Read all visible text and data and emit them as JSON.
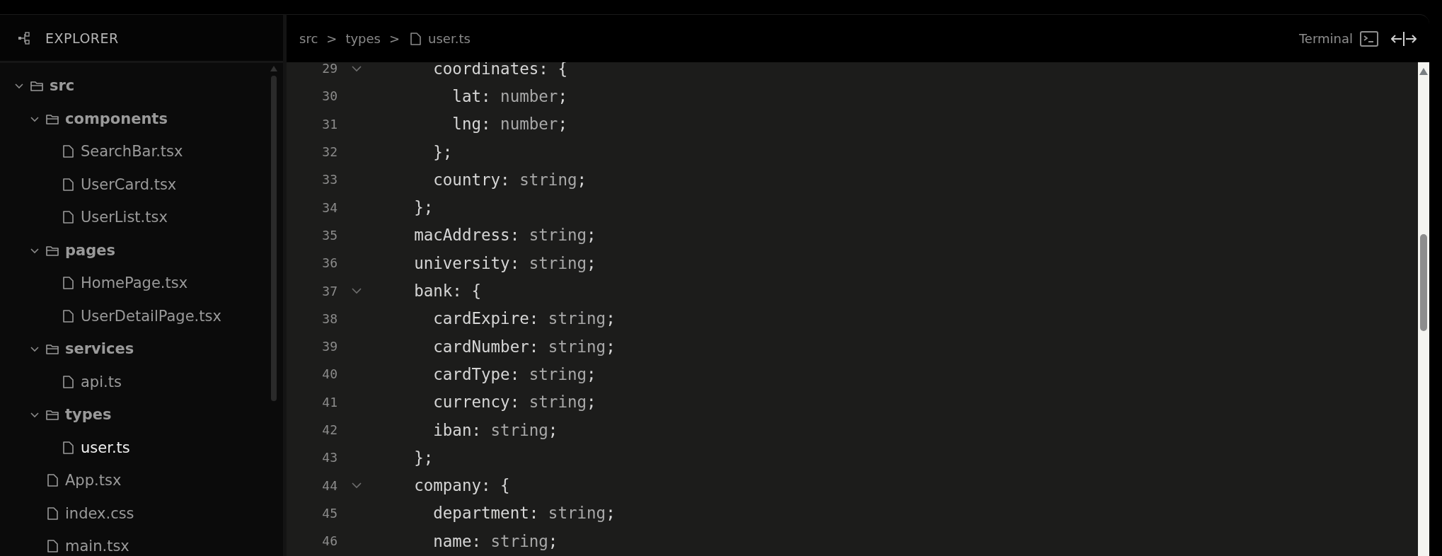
{
  "sidebar": {
    "title": "EXPLORER",
    "tree": [
      {
        "kind": "folder",
        "label": "src",
        "expanded": true,
        "children": [
          {
            "kind": "folder",
            "label": "components",
            "expanded": true,
            "children": [
              {
                "kind": "file",
                "label": "SearchBar.tsx",
                "selected": false
              },
              {
                "kind": "file",
                "label": "UserCard.tsx",
                "selected": false
              },
              {
                "kind": "file",
                "label": "UserList.tsx",
                "selected": false
              }
            ]
          },
          {
            "kind": "folder",
            "label": "pages",
            "expanded": true,
            "children": [
              {
                "kind": "file",
                "label": "HomePage.tsx",
                "selected": false
              },
              {
                "kind": "file",
                "label": "UserDetailPage.tsx",
                "selected": false
              }
            ]
          },
          {
            "kind": "folder",
            "label": "services",
            "expanded": true,
            "children": [
              {
                "kind": "file",
                "label": "api.ts",
                "selected": false
              }
            ]
          },
          {
            "kind": "folder",
            "label": "types",
            "expanded": true,
            "children": [
              {
                "kind": "file",
                "label": "user.ts",
                "selected": true
              }
            ]
          },
          {
            "kind": "file",
            "label": "App.tsx",
            "selected": false
          },
          {
            "kind": "file",
            "label": "index.css",
            "selected": false
          },
          {
            "kind": "file",
            "label": "main.tsx",
            "selected": false
          }
        ]
      }
    ]
  },
  "editor": {
    "breadcrumb": [
      {
        "kind": "folder",
        "text": "src"
      },
      {
        "kind": "separator",
        "text": ">"
      },
      {
        "kind": "folder",
        "text": "types"
      },
      {
        "kind": "separator",
        "text": ">"
      },
      {
        "kind": "file",
        "text": "user.ts"
      }
    ],
    "terminal_button": {
      "label": "Terminal"
    },
    "lines": [
      {
        "number": "29",
        "foldable": true,
        "tokens": [
          {
            "kind": "plain",
            "text": "      coordinates: {"
          }
        ]
      },
      {
        "number": "30",
        "foldable": false,
        "tokens": [
          {
            "kind": "plain",
            "text": "        lat: "
          },
          {
            "kind": "type",
            "text": "number"
          },
          {
            "kind": "plain",
            "text": ";"
          }
        ]
      },
      {
        "number": "31",
        "foldable": false,
        "tokens": [
          {
            "kind": "plain",
            "text": "        lng: "
          },
          {
            "kind": "type",
            "text": "number"
          },
          {
            "kind": "plain",
            "text": ";"
          }
        ]
      },
      {
        "number": "32",
        "foldable": false,
        "tokens": [
          {
            "kind": "plain",
            "text": "      };"
          }
        ]
      },
      {
        "number": "33",
        "foldable": false,
        "tokens": [
          {
            "kind": "plain",
            "text": "      country: "
          },
          {
            "kind": "type",
            "text": "string"
          },
          {
            "kind": "plain",
            "text": ";"
          }
        ]
      },
      {
        "number": "34",
        "foldable": false,
        "tokens": [
          {
            "kind": "plain",
            "text": "    };"
          }
        ]
      },
      {
        "number": "35",
        "foldable": false,
        "tokens": [
          {
            "kind": "plain",
            "text": "    macAddress: "
          },
          {
            "kind": "type",
            "text": "string"
          },
          {
            "kind": "plain",
            "text": ";"
          }
        ]
      },
      {
        "number": "36",
        "foldable": false,
        "tokens": [
          {
            "kind": "plain",
            "text": "    university: "
          },
          {
            "kind": "type",
            "text": "string"
          },
          {
            "kind": "plain",
            "text": ";"
          }
        ]
      },
      {
        "number": "37",
        "foldable": true,
        "tokens": [
          {
            "kind": "plain",
            "text": "    bank: {"
          }
        ]
      },
      {
        "number": "38",
        "foldable": false,
        "tokens": [
          {
            "kind": "plain",
            "text": "      cardExpire: "
          },
          {
            "kind": "type",
            "text": "string"
          },
          {
            "kind": "plain",
            "text": ";"
          }
        ]
      },
      {
        "number": "39",
        "foldable": false,
        "tokens": [
          {
            "kind": "plain",
            "text": "      cardNumber: "
          },
          {
            "kind": "type",
            "text": "string"
          },
          {
            "kind": "plain",
            "text": ";"
          }
        ]
      },
      {
        "number": "40",
        "foldable": false,
        "tokens": [
          {
            "kind": "plain",
            "text": "      cardType: "
          },
          {
            "kind": "type",
            "text": "string"
          },
          {
            "kind": "plain",
            "text": ";"
          }
        ]
      },
      {
        "number": "41",
        "foldable": false,
        "tokens": [
          {
            "kind": "plain",
            "text": "      currency: "
          },
          {
            "kind": "type",
            "text": "string"
          },
          {
            "kind": "plain",
            "text": ";"
          }
        ]
      },
      {
        "number": "42",
        "foldable": false,
        "tokens": [
          {
            "kind": "plain",
            "text": "      iban: "
          },
          {
            "kind": "type",
            "text": "string"
          },
          {
            "kind": "plain",
            "text": ";"
          }
        ]
      },
      {
        "number": "43",
        "foldable": false,
        "tokens": [
          {
            "kind": "plain",
            "text": "    };"
          }
        ]
      },
      {
        "number": "44",
        "foldable": true,
        "tokens": [
          {
            "kind": "plain",
            "text": "    company: {"
          }
        ]
      },
      {
        "number": "45",
        "foldable": false,
        "tokens": [
          {
            "kind": "plain",
            "text": "      department: "
          },
          {
            "kind": "type",
            "text": "string"
          },
          {
            "kind": "plain",
            "text": ";"
          }
        ]
      },
      {
        "number": "46",
        "foldable": false,
        "tokens": [
          {
            "kind": "plain",
            "text": "      name: "
          },
          {
            "kind": "type",
            "text": "string"
          },
          {
            "kind": "plain",
            "text": ";"
          }
        ]
      }
    ]
  }
}
